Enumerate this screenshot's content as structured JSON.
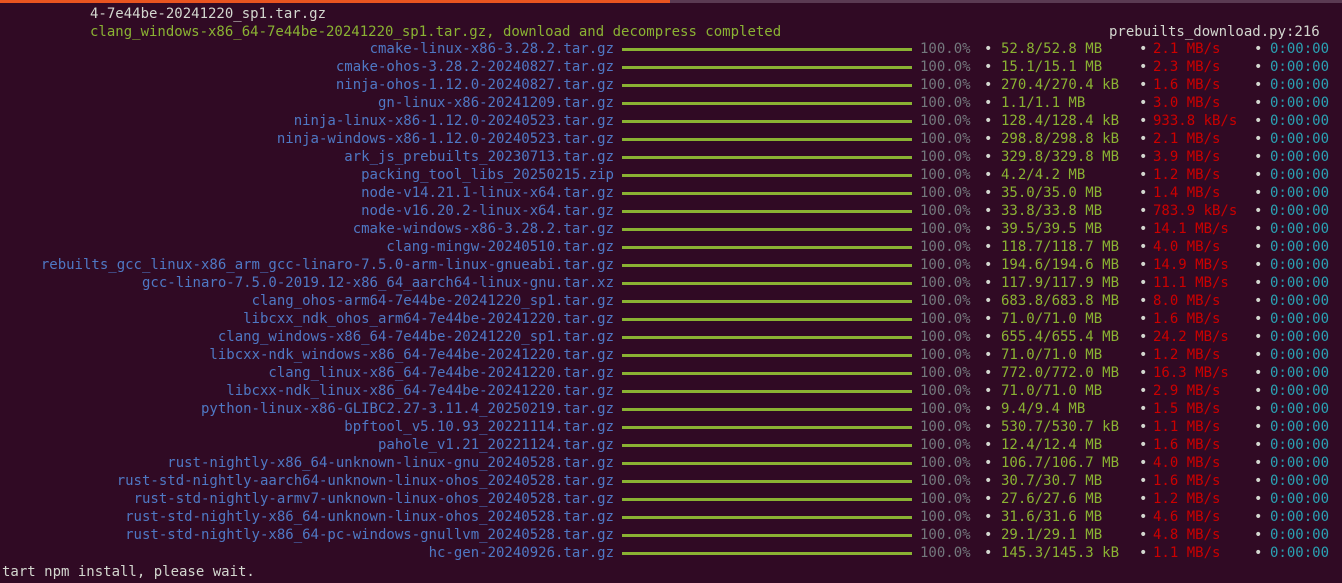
{
  "header": {
    "line1": "4-7e44be-20241220_sp1.tar.gz",
    "line2": "clang_windows-x86_64-7e44be-20241220_sp1.tar.gz, download and decompress completed",
    "source": "prebuilts_download.py:216"
  },
  "colors": {
    "background": "#300a24",
    "filename": "#4f78c4",
    "bar": "#8ab233",
    "speed": "#cc0000",
    "eta": "#2aa1b3",
    "accent": "#e95420"
  },
  "downloads": [
    {
      "name": "cmake-linux-x86-3.28.2.tar.gz",
      "percent": "100.0%",
      "size": "52.8/52.8 MB",
      "speed": "2.1 MB/s",
      "eta": "0:00:00"
    },
    {
      "name": "cmake-ohos-3.28.2-20240827.tar.gz",
      "percent": "100.0%",
      "size": "15.1/15.1 MB",
      "speed": "2.3 MB/s",
      "eta": "0:00:00"
    },
    {
      "name": "ninja-ohos-1.12.0-20240827.tar.gz",
      "percent": "100.0%",
      "size": "270.4/270.4 kB",
      "speed": "1.6 MB/s",
      "eta": "0:00:00"
    },
    {
      "name": "gn-linux-x86-20241209.tar.gz",
      "percent": "100.0%",
      "size": "1.1/1.1 MB",
      "speed": "3.0 MB/s",
      "eta": "0:00:00"
    },
    {
      "name": "ninja-linux-x86-1.12.0-20240523.tar.gz",
      "percent": "100.0%",
      "size": "128.4/128.4 kB",
      "speed": "933.8 kB/s",
      "eta": "0:00:00"
    },
    {
      "name": "ninja-windows-x86-1.12.0-20240523.tar.gz",
      "percent": "100.0%",
      "size": "298.8/298.8 kB",
      "speed": "2.1 MB/s",
      "eta": "0:00:00"
    },
    {
      "name": "ark_js_prebuilts_20230713.tar.gz",
      "percent": "100.0%",
      "size": "329.8/329.8 MB",
      "speed": "3.9 MB/s",
      "eta": "0:00:00"
    },
    {
      "name": "packing_tool_libs_20250215.zip",
      "percent": "100.0%",
      "size": "4.2/4.2 MB",
      "speed": "1.2 MB/s",
      "eta": "0:00:00"
    },
    {
      "name": "node-v14.21.1-linux-x64.tar.gz",
      "percent": "100.0%",
      "size": "35.0/35.0 MB",
      "speed": "1.4 MB/s",
      "eta": "0:00:00"
    },
    {
      "name": "node-v16.20.2-linux-x64.tar.gz",
      "percent": "100.0%",
      "size": "33.8/33.8 MB",
      "speed": "783.9 kB/s",
      "eta": "0:00:00"
    },
    {
      "name": "cmake-windows-x86-3.28.2.tar.gz",
      "percent": "100.0%",
      "size": "39.5/39.5 MB",
      "speed": "14.1 MB/s",
      "eta": "0:00:00"
    },
    {
      "name": "clang-mingw-20240510.tar.gz",
      "percent": "100.0%",
      "size": "118.7/118.7 MB",
      "speed": "4.0 MB/s",
      "eta": "0:00:00"
    },
    {
      "name": "rebuilts_gcc_linux-x86_arm_gcc-linaro-7.5.0-arm-linux-gnueabi.tar.gz",
      "percent": "100.0%",
      "size": "194.6/194.6 MB",
      "speed": "14.9 MB/s",
      "eta": "0:00:00"
    },
    {
      "name": "gcc-linaro-7.5.0-2019.12-x86_64_aarch64-linux-gnu.tar.xz",
      "percent": "100.0%",
      "size": "117.9/117.9 MB",
      "speed": "11.1 MB/s",
      "eta": "0:00:00"
    },
    {
      "name": "clang_ohos-arm64-7e44be-20241220_sp1.tar.gz",
      "percent": "100.0%",
      "size": "683.8/683.8 MB",
      "speed": "8.0 MB/s",
      "eta": "0:00:00"
    },
    {
      "name": "libcxx_ndk_ohos_arm64-7e44be-20241220.tar.gz",
      "percent": "100.0%",
      "size": "71.0/71.0 MB",
      "speed": "1.6 MB/s",
      "eta": "0:00:00"
    },
    {
      "name": "clang_windows-x86_64-7e44be-20241220_sp1.tar.gz",
      "percent": "100.0%",
      "size": "655.4/655.4 MB",
      "speed": "24.2 MB/s",
      "eta": "0:00:00"
    },
    {
      "name": "libcxx-ndk_windows-x86_64-7e44be-20241220.tar.gz",
      "percent": "100.0%",
      "size": "71.0/71.0 MB",
      "speed": "1.2 MB/s",
      "eta": "0:00:00"
    },
    {
      "name": "clang_linux-x86_64-7e44be-20241220.tar.gz",
      "percent": "100.0%",
      "size": "772.0/772.0 MB",
      "speed": "16.3 MB/s",
      "eta": "0:00:00"
    },
    {
      "name": "libcxx-ndk_linux-x86_64-7e44be-20241220.tar.gz",
      "percent": "100.0%",
      "size": "71.0/71.0 MB",
      "speed": "2.9 MB/s",
      "eta": "0:00:00"
    },
    {
      "name": "python-linux-x86-GLIBC2.27-3.11.4_20250219.tar.gz",
      "percent": "100.0%",
      "size": "9.4/9.4 MB",
      "speed": "1.5 MB/s",
      "eta": "0:00:00"
    },
    {
      "name": "bpftool_v5.10.93_20221114.tar.gz",
      "percent": "100.0%",
      "size": "530.7/530.7 kB",
      "speed": "1.1 MB/s",
      "eta": "0:00:00"
    },
    {
      "name": "pahole_v1.21_20221124.tar.gz",
      "percent": "100.0%",
      "size": "12.4/12.4 MB",
      "speed": "1.6 MB/s",
      "eta": "0:00:00"
    },
    {
      "name": "rust-nightly-x86_64-unknown-linux-gnu_20240528.tar.gz",
      "percent": "100.0%",
      "size": "106.7/106.7 MB",
      "speed": "4.0 MB/s",
      "eta": "0:00:00"
    },
    {
      "name": "rust-std-nightly-aarch64-unknown-linux-ohos_20240528.tar.gz",
      "percent": "100.0%",
      "size": "30.7/30.7 MB",
      "speed": "1.6 MB/s",
      "eta": "0:00:00"
    },
    {
      "name": "rust-std-nightly-armv7-unknown-linux-ohos_20240528.tar.gz",
      "percent": "100.0%",
      "size": "27.6/27.6 MB",
      "speed": "1.2 MB/s",
      "eta": "0:00:00"
    },
    {
      "name": "rust-std-nightly-x86_64-unknown-linux-ohos_20240528.tar.gz",
      "percent": "100.0%",
      "size": "31.6/31.6 MB",
      "speed": "4.6 MB/s",
      "eta": "0:00:00"
    },
    {
      "name": "rust-std-nightly-x86_64-pc-windows-gnullvm_20240528.tar.gz",
      "percent": "100.0%",
      "size": "29.1/29.1 MB",
      "speed": "4.8 MB/s",
      "eta": "0:00:00"
    },
    {
      "name": "hc-gen-20240926.tar.gz",
      "percent": "100.0%",
      "size": "145.3/145.3 kB",
      "speed": "1.1 MB/s",
      "eta": "0:00:00"
    }
  ],
  "separator": "•",
  "footer": "tart npm install, please wait."
}
